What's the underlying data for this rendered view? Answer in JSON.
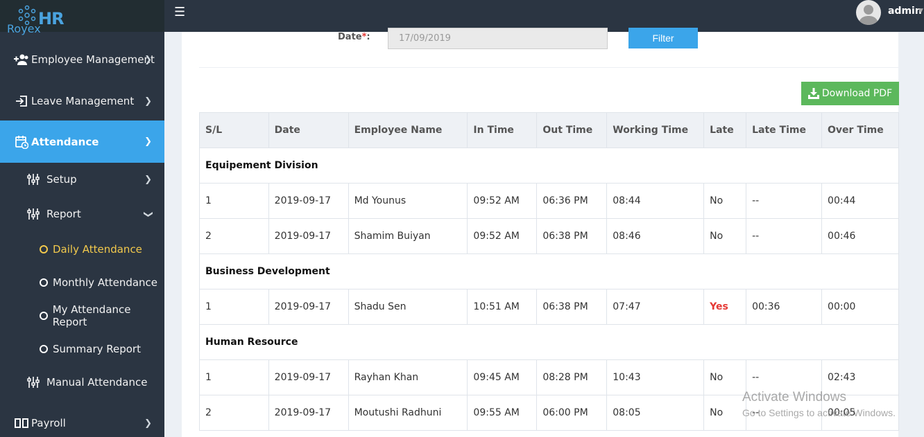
{
  "brand": {
    "short": "HR",
    "name": "Royex"
  },
  "user": {
    "name": "admin"
  },
  "sidebar": {
    "items": [
      {
        "label": "Employee Management",
        "icon": "users-plus-icon"
      },
      {
        "label": "Leave Management",
        "icon": "sign-in-icon"
      },
      {
        "label": "Attendance",
        "icon": "calendar-clock-icon",
        "active": true
      },
      {
        "label": "Setup",
        "icon": "sliders-icon"
      },
      {
        "label": "Report",
        "icon": "sliders-icon",
        "expanded": true
      },
      {
        "label": "Daily Attendance",
        "selected": true
      },
      {
        "label": "Monthly Attendance"
      },
      {
        "label": "My Attendance Report"
      },
      {
        "label": "Summary Report"
      },
      {
        "label": "Manual Attendance",
        "icon": "sliders-icon"
      },
      {
        "label": "Payroll",
        "icon": "book-open-icon"
      }
    ]
  },
  "filter": {
    "date_label": "Date",
    "required_mark": "*",
    "colon": ":",
    "date_value": "17/09/2019",
    "button": "Filter"
  },
  "download_button": "Download PDF",
  "table": {
    "headers": [
      "S/L",
      "Date",
      "Employee Name",
      "In Time",
      "Out Time",
      "Working Time",
      "Late",
      "Late Time",
      "Over Time"
    ],
    "groups": [
      {
        "name": "Equipement Division",
        "rows": [
          [
            "1",
            "2019-09-17",
            "Md Younus",
            "09:52 AM",
            "06:36 PM",
            "08:44",
            "No",
            "--",
            "00:44"
          ],
          [
            "2",
            "2019-09-17",
            "Shamim Buiyan",
            "09:52 AM",
            "06:38 PM",
            "08:46",
            "No",
            "--",
            "00:46"
          ]
        ]
      },
      {
        "name": "Business Development",
        "rows": [
          [
            "1",
            "2019-09-17",
            "Shadu Sen",
            "10:51 AM",
            "06:38 PM",
            "07:47",
            "Yes",
            "00:36",
            "00:00"
          ]
        ]
      },
      {
        "name": "Human Resource",
        "rows": [
          [
            "1",
            "2019-09-17",
            "Rayhan Khan",
            "09:45 AM",
            "08:28 PM",
            "10:43",
            "No",
            "--",
            "02:43"
          ],
          [
            "2",
            "2019-09-17",
            "Moutushi Radhuni",
            "09:55 AM",
            "06:00 PM",
            "08:05",
            "No",
            "--",
            "00:05"
          ]
        ]
      }
    ]
  },
  "watermark": {
    "title": "Activate Windows",
    "subtitle": "Go to Settings to activate Windows."
  },
  "colors": {
    "accent": "#3ba5ea",
    "sidebar": "#2b3542",
    "success": "#5cb85c",
    "danger": "#e53935",
    "selected": "#f2c94c"
  }
}
